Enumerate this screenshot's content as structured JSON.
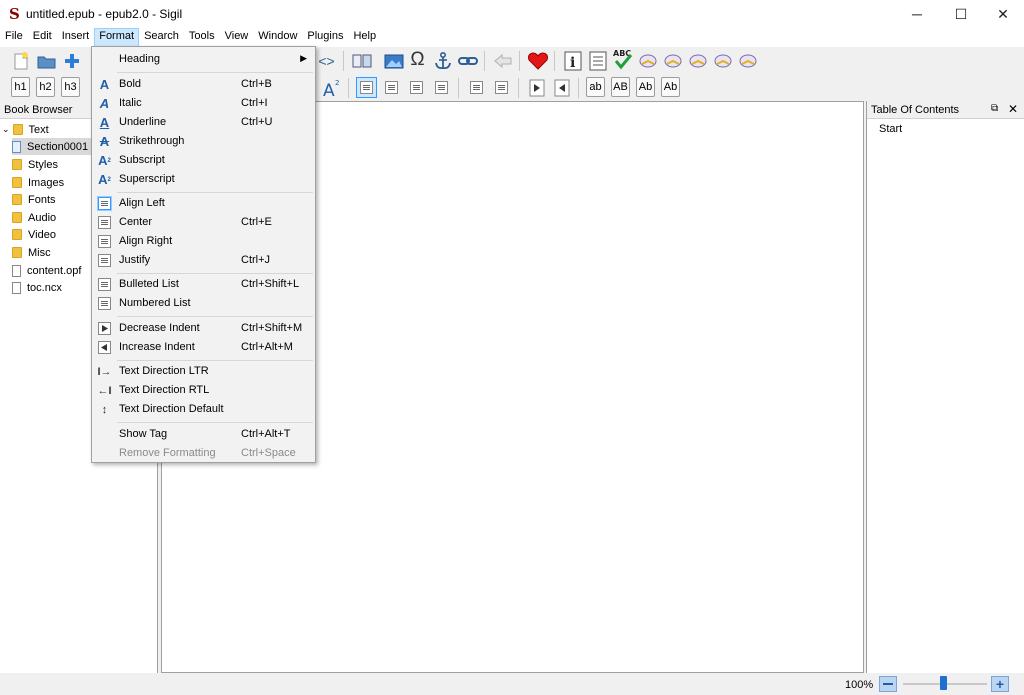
{
  "window": {
    "title": "untitled.epub - epub2.0 - Sigil",
    "logo": "S",
    "minimize": "─",
    "maximize": "☐",
    "close": "✕"
  },
  "menubar": [
    "File",
    "Edit",
    "Insert",
    "Format",
    "Search",
    "Tools",
    "View",
    "Window",
    "Plugins",
    "Help"
  ],
  "toolbar": {
    "headings": [
      "h1",
      "h2",
      "h3"
    ],
    "case_buttons": [
      "ab",
      "AB",
      "Ab",
      "Ab"
    ],
    "code_view": "<>",
    "omega": "Ω"
  },
  "book_browser": {
    "title": "Book Browser",
    "items": [
      {
        "label": "Text",
        "type": "folder"
      },
      {
        "label": "Section0001",
        "type": "file"
      },
      {
        "label": "Styles",
        "type": "folder"
      },
      {
        "label": "Images",
        "type": "folder"
      },
      {
        "label": "Fonts",
        "type": "folder"
      },
      {
        "label": "Audio",
        "type": "folder"
      },
      {
        "label": "Video",
        "type": "folder"
      },
      {
        "label": "Misc",
        "type": "folder"
      },
      {
        "label": "content.opf",
        "type": "file"
      },
      {
        "label": "toc.ncx",
        "type": "file"
      }
    ]
  },
  "toc": {
    "title": "Table Of Contents",
    "items": [
      "Start"
    ]
  },
  "format_menu": {
    "heading": "Heading",
    "items": [
      {
        "label": "Bold",
        "shortcut": "Ctrl+B",
        "icon": "bold-icon"
      },
      {
        "label": "Italic",
        "shortcut": "Ctrl+I",
        "icon": "italic-icon"
      },
      {
        "label": "Underline",
        "shortcut": "Ctrl+U",
        "icon": "underline-icon"
      },
      {
        "label": "Strikethrough",
        "shortcut": "",
        "icon": "strikethrough-icon"
      },
      {
        "label": "Subscript",
        "shortcut": "",
        "icon": "subscript-icon"
      },
      {
        "label": "Superscript",
        "shortcut": "",
        "icon": "superscript-icon"
      },
      {
        "label": "Align Left",
        "shortcut": "",
        "icon": "align-left-icon"
      },
      {
        "label": "Center",
        "shortcut": "Ctrl+E",
        "icon": "align-center-icon"
      },
      {
        "label": "Align Right",
        "shortcut": "",
        "icon": "align-right-icon"
      },
      {
        "label": "Justify",
        "shortcut": "Ctrl+J",
        "icon": "justify-icon"
      },
      {
        "label": "Bulleted List",
        "shortcut": "Ctrl+Shift+L",
        "icon": "bulleted-list-icon"
      },
      {
        "label": "Numbered List",
        "shortcut": "",
        "icon": "numbered-list-icon"
      },
      {
        "label": "Decrease Indent",
        "shortcut": "Ctrl+Shift+M",
        "icon": "decrease-indent-icon"
      },
      {
        "label": "Increase Indent",
        "shortcut": "Ctrl+Alt+M",
        "icon": "increase-indent-icon"
      },
      {
        "label": "Text Direction LTR",
        "shortcut": "",
        "icon": "text-direction-ltr-icon"
      },
      {
        "label": "Text Direction RTL",
        "shortcut": "",
        "icon": "text-direction-rtl-icon"
      },
      {
        "label": "Text Direction Default",
        "shortcut": "",
        "icon": "text-direction-default-icon"
      },
      {
        "label": "Show Tag",
        "shortcut": "Ctrl+Alt+T",
        "icon": ""
      },
      {
        "label": "Remove Formatting",
        "shortcut": "Ctrl+Space",
        "icon": "",
        "disabled": true
      }
    ]
  },
  "statusbar": {
    "zoom": "100%"
  },
  "colors": {
    "menu_active_bg": "#cce8ff",
    "folder": "#f0c040",
    "icon_blue": "#1f5fa6",
    "logo": "#8b0000"
  }
}
